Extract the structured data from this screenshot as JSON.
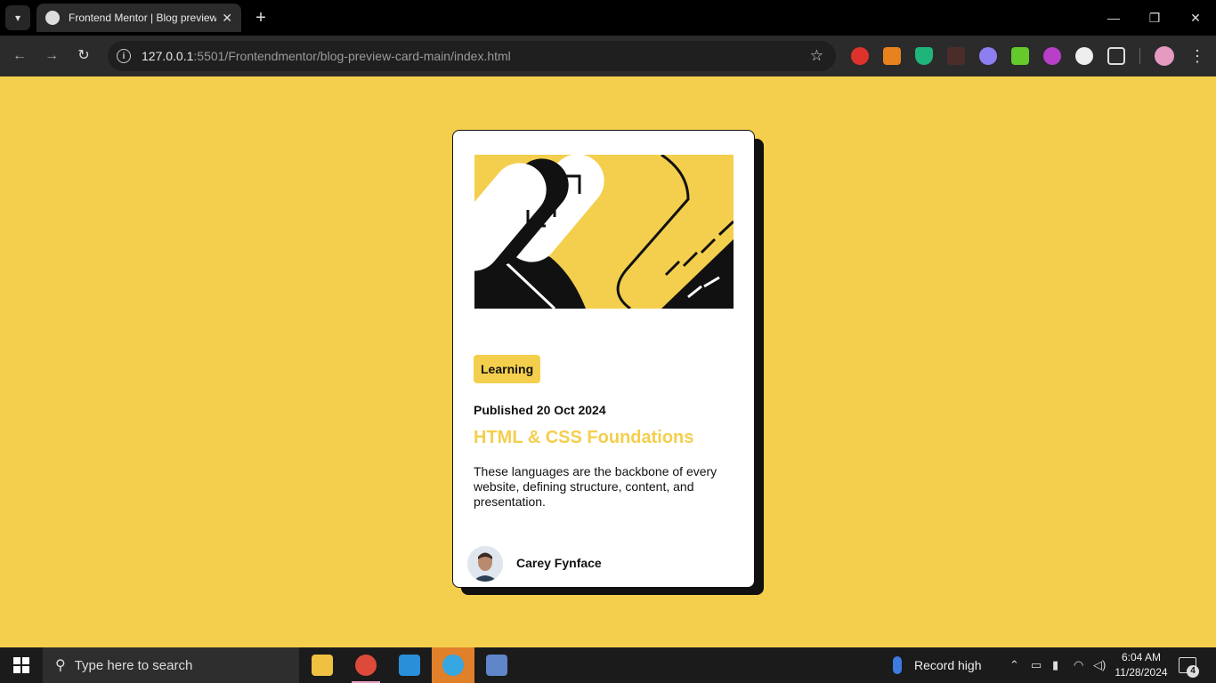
{
  "browser": {
    "tab_title": "Frontend Mentor | Blog preview card",
    "url_host": "127.0.0.1",
    "url_rest": ":5501/Frontendmentor/blog-preview-card-main/index.html",
    "tab_close": "✕",
    "new_tab": "+",
    "minimize": "—",
    "restore": "❐",
    "close": "✕"
  },
  "card": {
    "tag": "Learning",
    "published": "Published 20 Oct 2024",
    "headline": "HTML & CSS Foundations",
    "description": "These languages are the backbone of every website, defining structure, content, and presentation.",
    "author": "Carey Fynface"
  },
  "taskbar": {
    "search_placeholder": "Type here to search",
    "weather": "Record high",
    "time": "6:04 AM",
    "date": "11/28/2024",
    "notifications": "4"
  },
  "colors": {
    "page_bg": "#f4cf4d",
    "accent": "#f4cf4d",
    "card_bg": "#ffffff",
    "text": "#111111"
  }
}
